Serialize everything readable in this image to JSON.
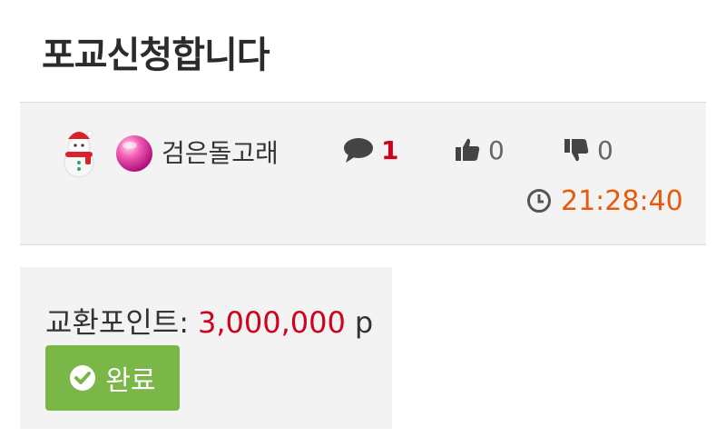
{
  "post": {
    "title": "포교신청합니다",
    "author": "검은돌고래",
    "comments": "1",
    "likes": "0",
    "dislikes": "0",
    "time": "21:28:40"
  },
  "exchange": {
    "label": "교환포인트:",
    "value": "3,000,000",
    "unit": "p",
    "status_button": "완료"
  },
  "icons": {
    "author_badge": "snowman-icon",
    "author_level": "pink-orb-icon",
    "comments": "comment-icon",
    "likes": "thumbs-up-icon",
    "dislikes": "thumbs-down-icon",
    "time": "clock-icon",
    "status": "check-circle-icon"
  },
  "colors": {
    "accent_red": "#d0021b",
    "time_orange": "#e8590c",
    "done_green": "#7ab648",
    "panel_bg": "#f3f3f3"
  }
}
